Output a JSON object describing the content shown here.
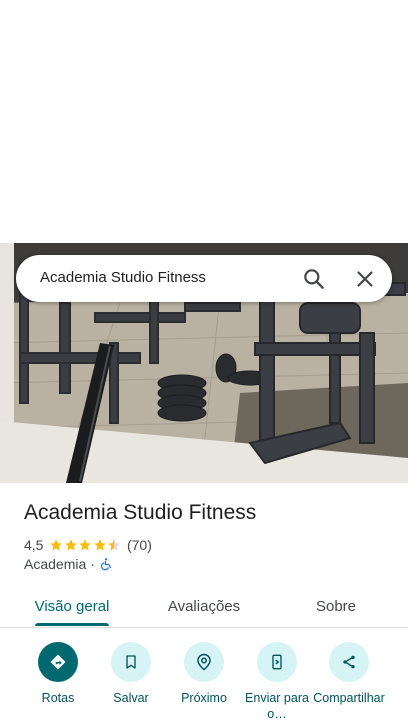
{
  "search": {
    "query": "Academia Studio Fitness"
  },
  "place": {
    "name": "Academia Studio Fitness",
    "rating": "4,5",
    "rating_value": 4.5,
    "review_count": "(70)",
    "category": "Academia",
    "separator": "·"
  },
  "tabs": [
    {
      "label": "Visão geral",
      "active": true
    },
    {
      "label": "Avaliações",
      "active": false
    },
    {
      "label": "Sobre",
      "active": false
    }
  ],
  "actions": [
    {
      "label": "Rotas",
      "icon": "directions-icon"
    },
    {
      "label": "Salvar",
      "icon": "bookmark-icon"
    },
    {
      "label": "Próximo",
      "icon": "nearby-icon"
    },
    {
      "label": "Enviar para o…",
      "icon": "send-to-phone-icon"
    },
    {
      "label": "Compartilhar",
      "icon": "share-icon"
    }
  ],
  "colors": {
    "accent": "#00696f",
    "star": "#fbbc04",
    "action_bg": "#d6f3f5"
  }
}
